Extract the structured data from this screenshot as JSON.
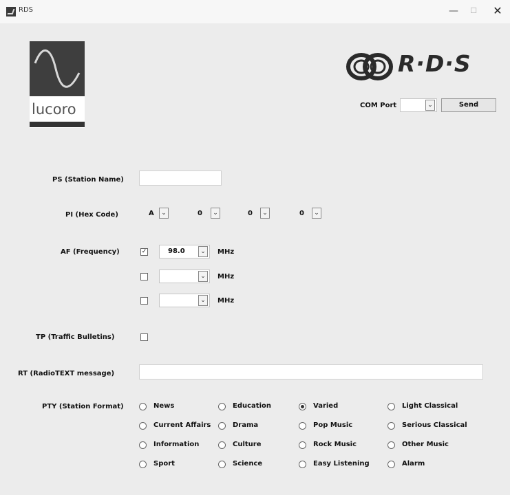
{
  "window": {
    "title": "RDS",
    "minimize_glyph": "—",
    "maximize_glyph": "☐",
    "close_glyph": "✕"
  },
  "branding": {
    "lucoro_text": "lucoro",
    "rds_text": "R·D·S"
  },
  "com": {
    "label": "COM Port",
    "selected": "",
    "send_label": "Send"
  },
  "ps": {
    "label": "PS (Station Name)",
    "value": ""
  },
  "pi": {
    "label": "PI (Hex Code)",
    "digits": [
      "A",
      "0",
      "0",
      "0"
    ]
  },
  "af": {
    "label": "AF (Frequency)",
    "unit": "MHz",
    "rows": [
      {
        "checked": true,
        "value": "98.0"
      },
      {
        "checked": false,
        "value": ""
      },
      {
        "checked": false,
        "value": ""
      }
    ]
  },
  "tp": {
    "label": "TP (Traffic Bulletins)",
    "checked": false
  },
  "rt": {
    "label": "RT (RadioTEXT message)",
    "value": ""
  },
  "pty": {
    "label": "PTY (Station Format)",
    "selected": "Varied",
    "columns": [
      [
        "News",
        "Current Affairs",
        "Information",
        "Sport"
      ],
      [
        "Education",
        "Drama",
        "Culture",
        "Science"
      ],
      [
        "Varied",
        "Pop Music",
        "Rock Music",
        "Easy Listening"
      ],
      [
        "Light Classical",
        "Serious Classical",
        "Other Music",
        "Alarm"
      ]
    ]
  },
  "icons": {
    "dropdown": "chevron-down-icon",
    "checkmark": "✓"
  },
  "colors": {
    "background": "#ececec",
    "titlebar": "#f7f7f7",
    "logo_dark": "#3e3e3e"
  }
}
